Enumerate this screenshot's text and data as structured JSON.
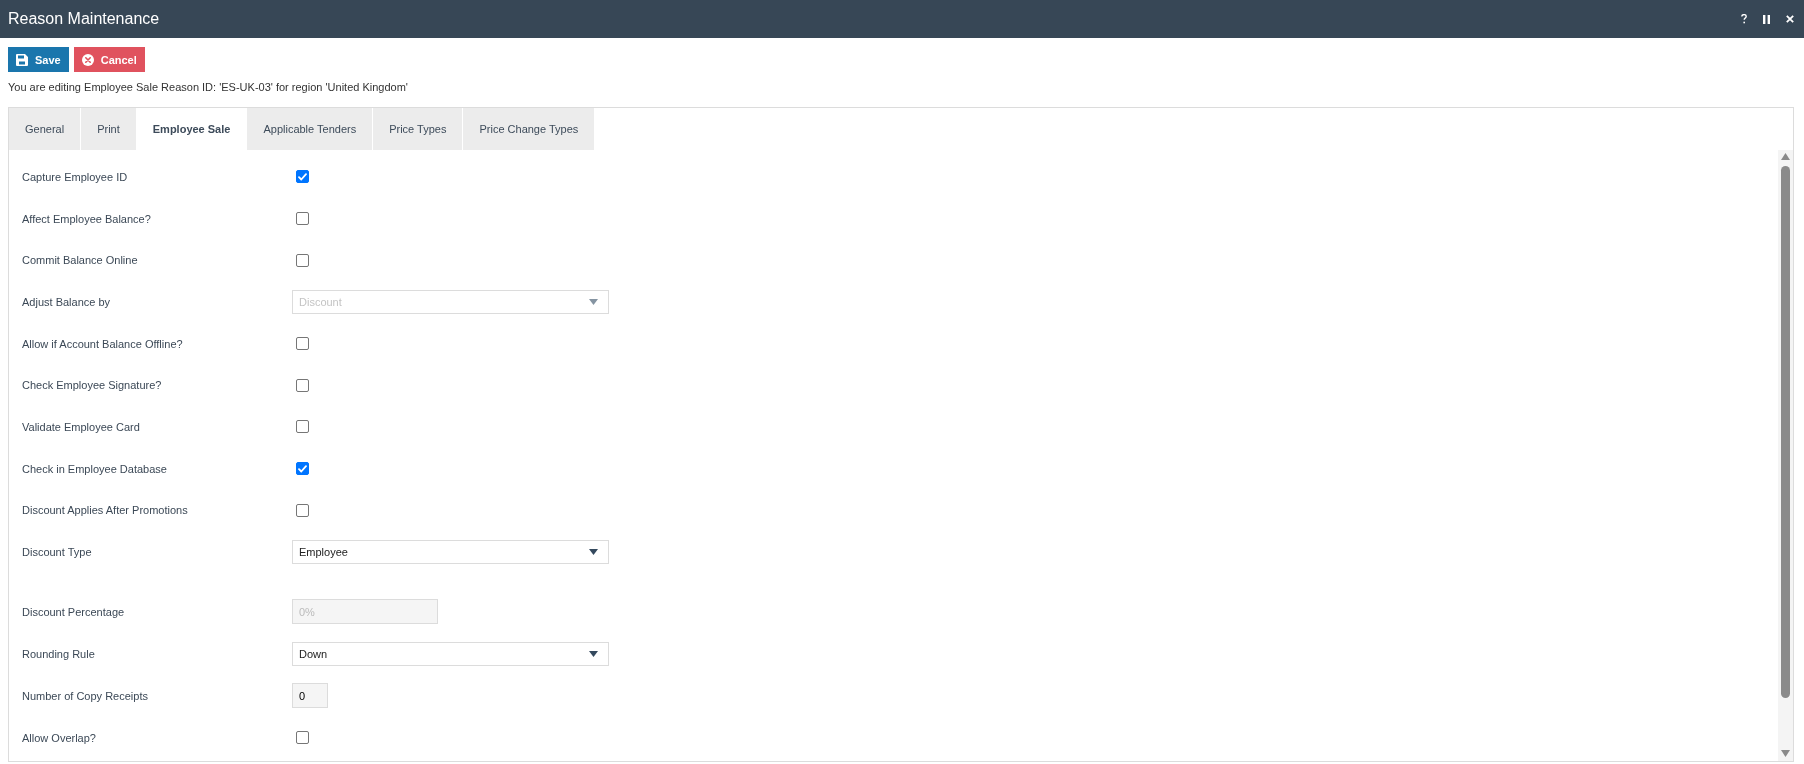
{
  "window": {
    "title": "Reason Maintenance"
  },
  "actions": [
    {
      "kind": "save",
      "label": "Save"
    },
    {
      "kind": "cancel",
      "label": "Cancel"
    }
  ],
  "info": "You are editing Employee Sale Reason ID: 'ES-UK-03' for region 'United Kingdom'",
  "tabs": [
    {
      "label": "General",
      "selected": false
    },
    {
      "label": "Print",
      "selected": false
    },
    {
      "label": "Employee Sale",
      "selected": true
    },
    {
      "label": "Applicable Tenders",
      "selected": false
    },
    {
      "label": "Price Types",
      "selected": false
    },
    {
      "label": "Price Change Types",
      "selected": false
    }
  ],
  "groups": [
    {
      "fields": [
        {
          "kind": "checkbox",
          "label": "Capture Employee ID",
          "checked": true
        },
        {
          "kind": "checkbox",
          "label": "Affect Employee Balance?",
          "checked": false
        },
        {
          "kind": "checkbox",
          "label": "Commit Balance Online",
          "checked": false
        },
        {
          "kind": "select",
          "label": "Adjust Balance by",
          "value": "Discount",
          "disabled": true
        },
        {
          "kind": "checkbox",
          "label": "Allow if Account Balance Offline?",
          "checked": false
        },
        {
          "kind": "checkbox",
          "label": "Check Employee Signature?",
          "checked": false
        },
        {
          "kind": "checkbox",
          "label": "Validate Employee Card",
          "checked": false
        },
        {
          "kind": "checkbox",
          "label": "Check in Employee Database",
          "checked": true
        },
        {
          "kind": "checkbox",
          "label": "Discount Applies After Promotions",
          "checked": false
        },
        {
          "kind": "select",
          "label": "Discount Type",
          "value": "Employee",
          "disabled": false
        }
      ]
    },
    {
      "fields": [
        {
          "kind": "percent",
          "label": "Discount Percentage",
          "value": "0%",
          "disabled": true
        },
        {
          "kind": "select",
          "label": "Rounding Rule",
          "value": "Down",
          "disabled": false
        },
        {
          "kind": "number",
          "label": "Number of Copy Receipts",
          "value": "0",
          "disabled": false
        },
        {
          "kind": "checkbox",
          "label": "Allow Overlap?",
          "checked": false
        }
      ]
    }
  ]
}
